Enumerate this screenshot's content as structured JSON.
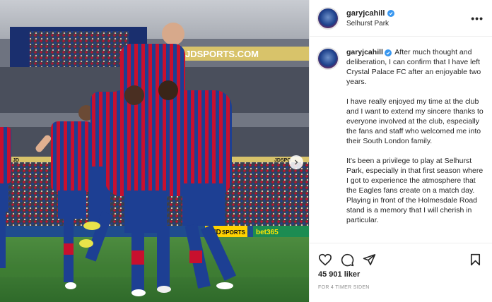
{
  "post": {
    "username": "garyjcahill",
    "location": "Selhurst Park",
    "more_label": "•••",
    "verified_icon": "verified-badge-icon",
    "accent": "#3897f0"
  },
  "photo": {
    "billboard_text": "JDSPORTS.COM",
    "banner_left": "JD",
    "banner_right": "JDSPO",
    "board_bet": "bet365",
    "board_jd": "JD",
    "board_sp": "SPORTS",
    "kit_blue": "#1d3f93",
    "kit_red": "#c8102e",
    "pitch_green": "#3d7a35"
  },
  "caption": {
    "paragraphs": [
      "After much thought and deliberation, I can confirm that I have left Crystal Palace FC after an enjoyable two years.",
      "I have really enjoyed my time at the club and I want to extend my sincere thanks to everyone involved at the club, especially the fans and staff who welcomed me into their South London family.",
      "It's been a privilege to play at Selhurst Park, especially in that first season where I got to experience the atmosphere that the Eagles fans create on a match day. Playing in front of the Holmesdale Road stand is a memory that I will cherish in particular."
    ]
  },
  "actions": {
    "like_icon": "heart-icon",
    "comment_icon": "comment-icon",
    "share_icon": "share-icon",
    "save_icon": "bookmark-icon",
    "likes": "45 901 liker",
    "time": "FOR 4 TIMER SIDEN"
  }
}
